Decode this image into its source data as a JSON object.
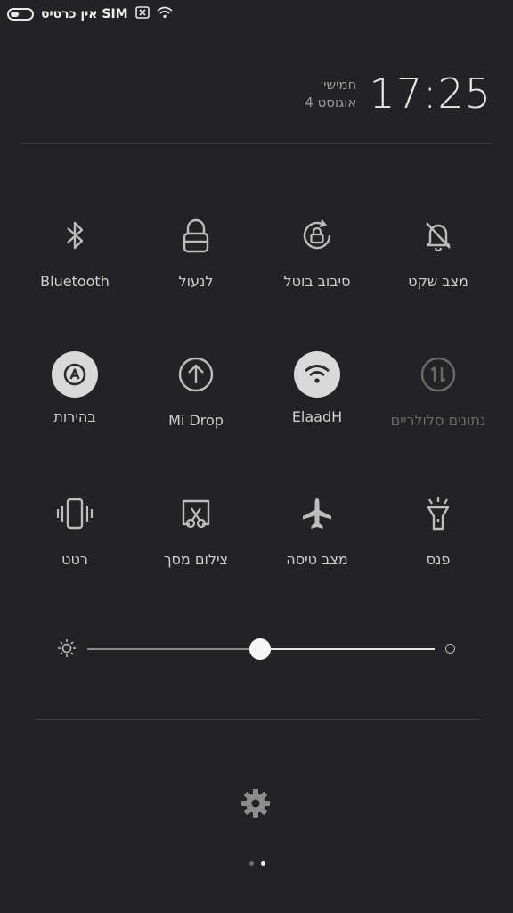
{
  "status_bar": {
    "carrier": "אין כרטיס SIM",
    "icons": [
      "battery-icon",
      "sim-blocked-icon",
      "wifi-icon"
    ]
  },
  "header": {
    "time": "17:25",
    "day": "חמישי",
    "date": "4 אוגוסט"
  },
  "toggles": [
    {
      "label": "Bluetooth",
      "icon": "bluetooth-icon",
      "active": false
    },
    {
      "label": "לנעול",
      "icon": "lock-icon",
      "active": false
    },
    {
      "label": "סיבוב בוטל",
      "icon": "rotation-lock-icon",
      "active": false
    },
    {
      "label": "מצב שקט",
      "icon": "silent-bell-icon",
      "active": false
    },
    {
      "label": "בהירות",
      "icon": "auto-brightness-icon",
      "active": true
    },
    {
      "label": "Mi Drop",
      "icon": "mi-drop-icon",
      "active": false
    },
    {
      "label": "ElaadH",
      "icon": "wifi-icon",
      "active": true
    },
    {
      "label": "נתונים סלולריים",
      "icon": "mobile-data-icon",
      "active": false,
      "disabled": true
    },
    {
      "label": "רטט",
      "icon": "vibrate-icon",
      "active": false
    },
    {
      "label": "צילום מסך",
      "icon": "screenshot-icon",
      "active": false
    },
    {
      "label": "מצב טיסה",
      "icon": "airplane-icon",
      "active": false
    },
    {
      "label": "פנס",
      "icon": "flashlight-icon",
      "active": false
    }
  ],
  "brightness": {
    "level": 0.46
  },
  "pager": {
    "pages": 2,
    "current": 2
  }
}
